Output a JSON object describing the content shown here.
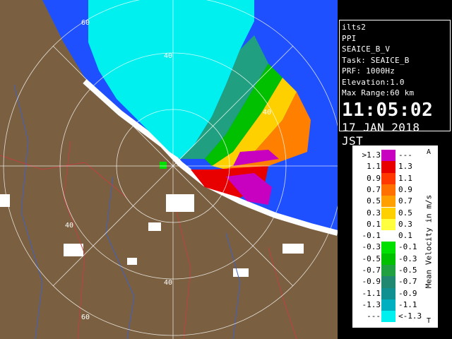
{
  "info": {
    "site": "ilts2",
    "product": "PPI",
    "scan": "SEAICE_B_V",
    "task": "Task: SEAICE_B",
    "prf": "PRF: 1000Hz",
    "elevation": "Elevation:1.0",
    "max_range": "Max Range:60 km",
    "time": "11:05:02",
    "date": "17 JAN 2018 JST"
  },
  "legend": {
    "title": "Mean Velocity in m/s",
    "arrow_top": "A",
    "arrow_bottom": "T",
    "rows": [
      {
        "lo": ">1.3",
        "hi": "---",
        "color": "#c800c0"
      },
      {
        "lo": "1.1",
        "hi": "1.3",
        "color": "#e80000"
      },
      {
        "lo": "0.9",
        "hi": "1.1",
        "color": "#ff3800"
      },
      {
        "lo": "0.7",
        "hi": "0.9",
        "color": "#ff7000"
      },
      {
        "lo": "0.5",
        "hi": "0.7",
        "color": "#ffa000"
      },
      {
        "lo": "0.3",
        "hi": "0.5",
        "color": "#ffd000"
      },
      {
        "lo": "0.1",
        "hi": "0.3",
        "color": "#ffff40"
      },
      {
        "lo": "-0.1",
        "hi": "0.1",
        "color": "#ffffff"
      },
      {
        "lo": "-0.3",
        "hi": "-0.1",
        "color": "#00e000"
      },
      {
        "lo": "-0.5",
        "hi": "-0.3",
        "color": "#00c000"
      },
      {
        "lo": "-0.7",
        "hi": "-0.5",
        "color": "#20a040"
      },
      {
        "lo": "-0.9",
        "hi": "-0.7",
        "color": "#208870"
      },
      {
        "lo": "-1.1",
        "hi": "-0.9",
        "color": "#109090"
      },
      {
        "lo": "-1.3",
        "hi": "-1.1",
        "color": "#00b0c0"
      },
      {
        "lo": "---",
        "hi": "<-1.3",
        "color": "#00f0f0"
      }
    ]
  },
  "map": {
    "range_labels": [
      "60",
      "40",
      "40",
      "40",
      "40",
      "60"
    ],
    "colors": {
      "ocean": "#1e50ff",
      "land": "#7a6040",
      "coast": "#ffffff",
      "rings": "#ffffff"
    }
  }
}
